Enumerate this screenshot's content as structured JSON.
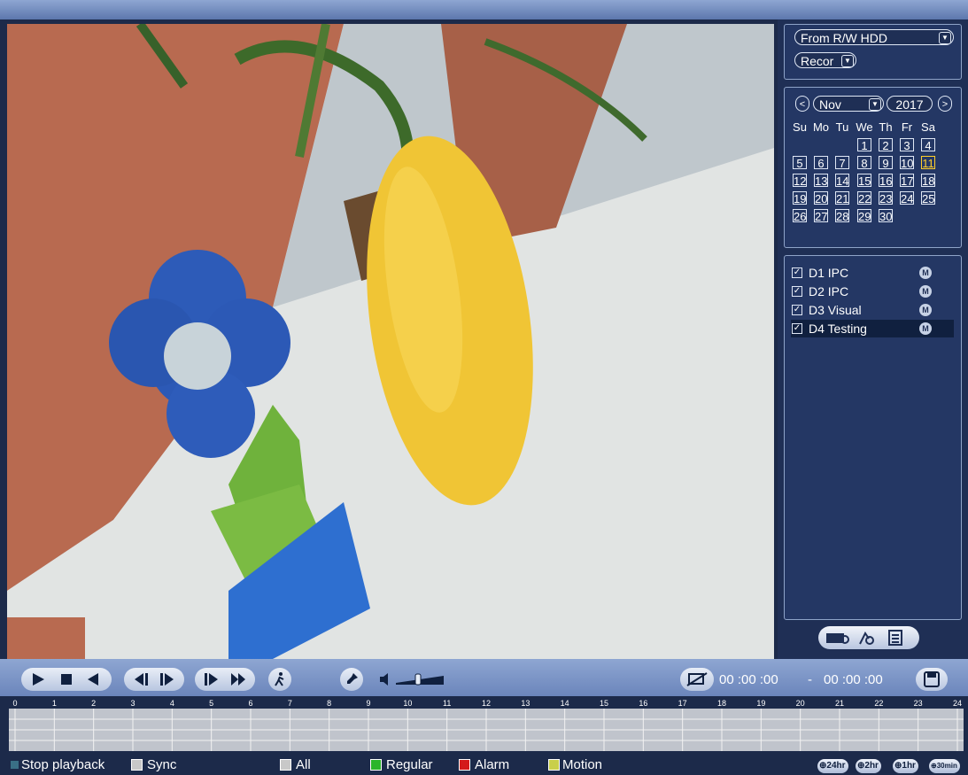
{
  "source": {
    "device_select": "From R/W HDD",
    "type_select": "Recor"
  },
  "calendar": {
    "month": "Nov",
    "year": "2017",
    "prev_label": "<",
    "next_label": ">",
    "weekdays": [
      "Su",
      "Mo",
      "Tu",
      "We",
      "Th",
      "Fr",
      "Sa"
    ],
    "today": "11",
    "weeks": [
      [
        "",
        "",
        "",
        "1",
        "2",
        "3",
        "4"
      ],
      [
        "5",
        "6",
        "7",
        "8",
        "9",
        "10",
        "11"
      ],
      [
        "12",
        "13",
        "14",
        "15",
        "16",
        "17",
        "18"
      ],
      [
        "19",
        "20",
        "21",
        "22",
        "23",
        "24",
        "25"
      ],
      [
        "26",
        "27",
        "28",
        "29",
        "30",
        "",
        ""
      ]
    ]
  },
  "channels": [
    {
      "label": "D1 IPC",
      "checked": true,
      "badge": "M"
    },
    {
      "label": "D2 IPC",
      "checked": true,
      "badge": "M"
    },
    {
      "label": "D3 Visual",
      "checked": true,
      "badge": "M"
    },
    {
      "label": "D4 Testing",
      "checked": true,
      "badge": "M"
    }
  ],
  "playback": {
    "start_time": "00 :00 :00",
    "separator": "-",
    "end_time": "00 :00 :00"
  },
  "timeline": {
    "hours": [
      "0",
      "1",
      "2",
      "3",
      "4",
      "5",
      "6",
      "7",
      "8",
      "9",
      "10",
      "11",
      "12",
      "13",
      "14",
      "15",
      "16",
      "17",
      "18",
      "19",
      "20",
      "21",
      "22",
      "23",
      "24"
    ]
  },
  "status": {
    "stop_playback": "Stop playback",
    "sync": "Sync",
    "all": "All",
    "regular": "Regular",
    "alarm": "Alarm",
    "motion": "Motion"
  },
  "zoom": {
    "z24": "24hr",
    "z2": "2hr",
    "z1": "1hr",
    "z30": "30min"
  },
  "colors": {
    "regular": "#2bb52b",
    "alarm": "#d41a1a",
    "motion": "#c9cf4a",
    "today": "#ffcf2a"
  }
}
